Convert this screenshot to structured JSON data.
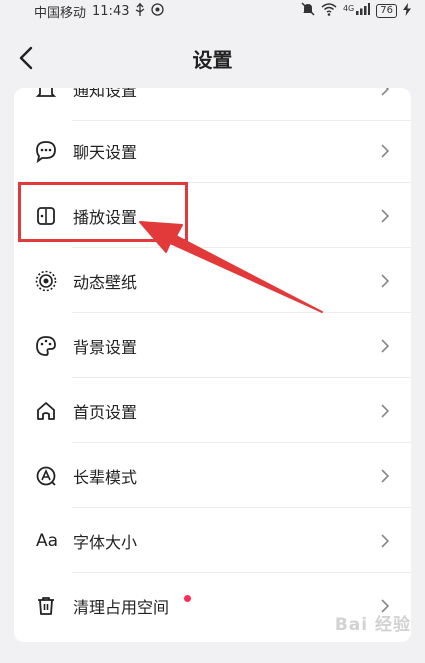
{
  "status_bar": {
    "carrier": "中国移动",
    "time": "11:43",
    "network": "4G",
    "battery": "76"
  },
  "header": {
    "title": "设置"
  },
  "settings": {
    "items": [
      {
        "label": "通知设置",
        "icon": "bell-icon"
      },
      {
        "label": "聊天设置",
        "icon": "chat-bubble-icon"
      },
      {
        "label": "播放设置",
        "icon": "play-panel-icon"
      },
      {
        "label": "动态壁纸",
        "icon": "dynamic-wallpaper-icon"
      },
      {
        "label": "背景设置",
        "icon": "palette-icon"
      },
      {
        "label": "首页设置",
        "icon": "home-icon"
      },
      {
        "label": "长辈模式",
        "icon": "elder-mode-icon"
      },
      {
        "label": "字体大小",
        "icon": "font-size-icon"
      },
      {
        "label": "清理占用空间",
        "icon": "trash-icon",
        "badge": "red-dot"
      }
    ]
  },
  "annotation": {
    "highlighted_item": "播放设置",
    "arrow_color": "#e23a3a"
  },
  "watermark": "Bai 经验",
  "colors": {
    "background": "#f1f1f4",
    "card": "#ffffff",
    "badge": "#ff2b55",
    "annotation": "#e23a3a"
  }
}
